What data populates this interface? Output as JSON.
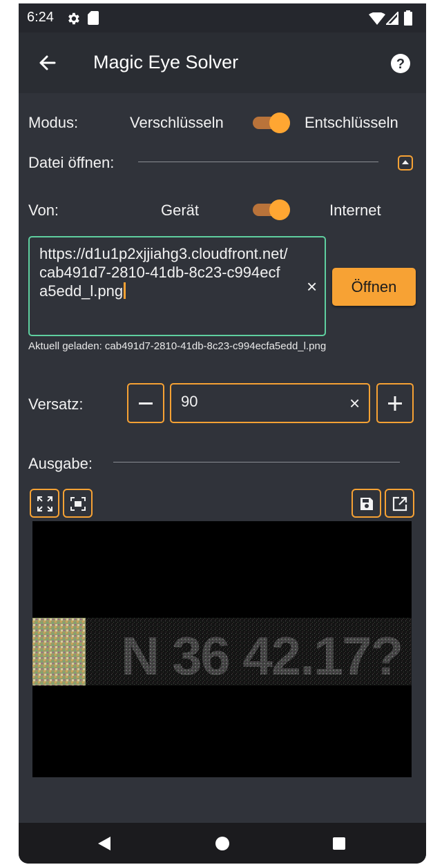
{
  "status_bar": {
    "time": "6:24",
    "icons": [
      "settings-gear-icon",
      "sd-card-icon",
      "wifi-icon",
      "signal-icon",
      "battery-icon"
    ]
  },
  "app_bar": {
    "title": "Magic Eye Solver",
    "back_icon": "arrow-left-icon",
    "help_icon": "help-circle-icon"
  },
  "mode": {
    "label": "Modus:",
    "left_option": "Verschlüsseln",
    "right_option": "Entschlüsseln",
    "switch_on": true
  },
  "open_file": {
    "label": "Datei öffnen:",
    "collapse_icon": "caret-up-icon"
  },
  "source": {
    "label": "Von:",
    "left_option": "Gerät",
    "right_option": "Internet",
    "switch_on": true
  },
  "url": {
    "value": "https://d1u1p2xjjiahg3.cloudfront.net/cab491d7-2810-41db-8c23-c994ecfa5edd_l.png",
    "clear_icon": "×",
    "open_button": "Öffnen",
    "loaded_text": "Aktuell geladen: cab491d7-2810-41db-8c23-c994ecfa5edd_l.png"
  },
  "offset": {
    "label": "Versatz:",
    "value": "90",
    "minus_icon": "minus-icon",
    "plus_icon": "plus-icon",
    "clear_icon": "×"
  },
  "output": {
    "label": "Ausgabe:",
    "toolbar_icons": [
      "fullscreen-expand-icon",
      "fit-screen-icon",
      "save-icon",
      "open-external-icon"
    ],
    "image_text": "N 36 42.17?"
  },
  "colors": {
    "accent": "#f7a234",
    "background": "#30333a",
    "field_focus": "#5fd0a0"
  },
  "nav_bar": {
    "icons": [
      "back-triangle-icon",
      "home-circle-icon",
      "recents-square-icon"
    ]
  }
}
